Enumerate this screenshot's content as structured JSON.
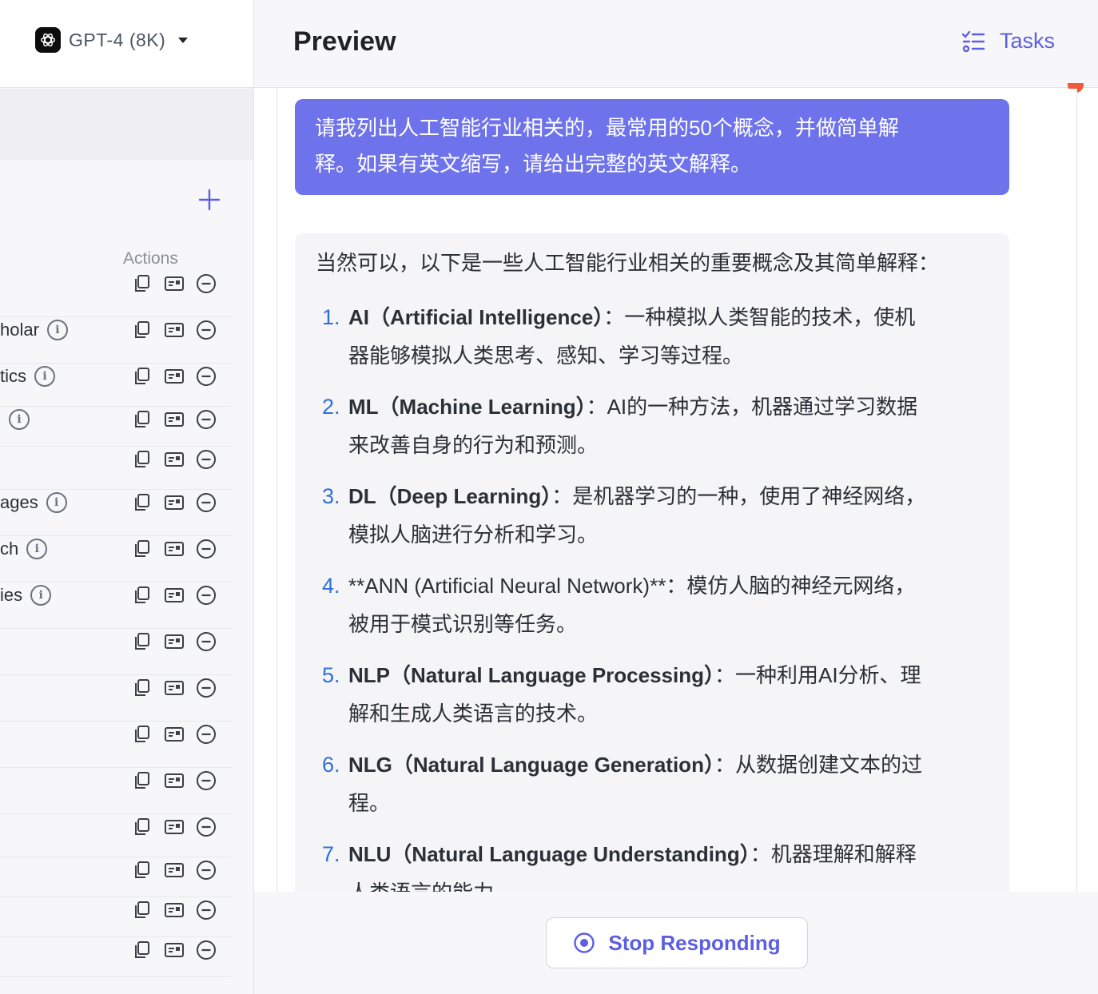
{
  "left_panel": {
    "model_select": {
      "value": "GPT-4 (8K)",
      "icon": "openai-logo-icon"
    },
    "add_icon": "plus-icon",
    "actions_header": "Actions",
    "row_action_icons": [
      "copy-icon",
      "card-icon",
      "remove-icon"
    ],
    "rows": [
      {
        "label": ""
      },
      {
        "label": "holar"
      },
      {
        "label": "tics"
      },
      {
        "label": ""
      },
      {
        "label": ""
      },
      {
        "label": "ages"
      },
      {
        "label": "ch"
      },
      {
        "label": "ies"
      },
      {
        "label": ""
      },
      {
        "label": ""
      },
      {
        "label": ""
      },
      {
        "label": ""
      },
      {
        "label": ""
      },
      {
        "label": ""
      },
      {
        "label": ""
      },
      {
        "label": ""
      }
    ]
  },
  "header": {
    "title": "Preview",
    "tasks_label": "Tasks"
  },
  "chat": {
    "user_message": {
      "line1": "请我列出人工智能行业相关的，最常用的50个概念，并做简单解",
      "line2": "释。如果有英文缩写，请给出完整的英文解释。"
    },
    "assistant": {
      "intro": "当然可以，以下是一些人工智能行业相关的重要概念及其简单解释：",
      "items": [
        {
          "num": "1.",
          "term": "AI（Artificial Intelligence）",
          "line1": "：一种模拟人类智能的技术，使机",
          "line2": "器能够模拟人类思考、感知、学习等过程。"
        },
        {
          "num": "2.",
          "term": "ML（Machine Learning）",
          "line1": "：AI的一种方法，机器通过学习数据",
          "line2": "来改善自身的行为和预测。"
        },
        {
          "num": "3.",
          "term": "DL（Deep Learning）",
          "line1": "：是机器学习的一种，使用了神经网络，",
          "line2": "模拟人脑进行分析和学习。"
        },
        {
          "num": "4.",
          "term": "",
          "line1": "**ANN (Artificial Neural Network)**：模仿人脑的神经元网络，",
          "line2": "被用于模式识别等任务。"
        },
        {
          "num": "5.",
          "term": "NLP（Natural Language Processing）",
          "line1": "：一种利用AI分析、理",
          "line2": "解和生成人类语言的技术。"
        },
        {
          "num": "6.",
          "term": "NLG（Natural Language Generation）",
          "line1": "：从数据创建文本的过",
          "line2": "程。"
        },
        {
          "num": "7.",
          "term": "NLU（Natural Language Understanding）",
          "line1": "：机器理解和解释",
          "line2": "人类语言的能力。"
        }
      ]
    }
  },
  "footer": {
    "stop_label": "Stop Responding"
  },
  "colors": {
    "accent": "#5b5fe0",
    "user_bubble": "#6e73ec",
    "list_number": "#2f6fdb",
    "status_dot": "#f05a3a"
  }
}
